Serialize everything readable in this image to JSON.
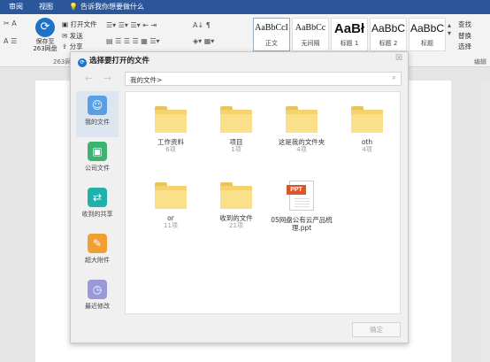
{
  "ribbon": {
    "tabs": [
      "审阅",
      "视图"
    ],
    "tell_me": "告诉我你想要做什么",
    "save263": "保存至263网盘",
    "group_label": "263网盘",
    "open_file": "打开文件",
    "send": "发送",
    "share": "分享",
    "styles": [
      {
        "sample": "AaBbCcI",
        "name": "正文"
      },
      {
        "sample": "AaBbCc",
        "name": "无间隔"
      },
      {
        "sample": "AaBł",
        "name": "标题 1"
      },
      {
        "sample": "AaBbC",
        "name": "标题 2"
      },
      {
        "sample": "AaBbC",
        "name": "标题"
      }
    ],
    "find": "查找",
    "replace": "替换",
    "select": "选择",
    "edit_group": "编辑"
  },
  "dialog": {
    "title": "选择要打开的文件",
    "path": "我的文件>",
    "sidebar": [
      {
        "label": "我的文件",
        "icon": "user-icon",
        "color": "#5a9ee6",
        "active": true
      },
      {
        "label": "公司文件",
        "icon": "briefcase-icon",
        "color": "#3cb371",
        "active": false
      },
      {
        "label": "收到的共享",
        "icon": "share-icon",
        "color": "#20b2aa",
        "active": false
      },
      {
        "label": "超大附件",
        "icon": "paperclip-icon",
        "color": "#f0a030",
        "active": false
      },
      {
        "label": "最近修改",
        "icon": "clock-icon",
        "color": "#9a9ad8",
        "active": false
      }
    ],
    "items": [
      {
        "name": "工作资料",
        "count": "6项",
        "type": "folder"
      },
      {
        "name": "项目",
        "count": "1项",
        "type": "folder"
      },
      {
        "name": "这是我的文件夹",
        "count": "4项",
        "type": "folder"
      },
      {
        "name": "oth",
        "count": "4项",
        "type": "folder"
      },
      {
        "name": "or",
        "count": "11项",
        "type": "folder"
      },
      {
        "name": "收到的文件",
        "count": "21项",
        "type": "folder"
      },
      {
        "name": "05网盘公有云产品梳理.ppt",
        "count": "",
        "type": "ppt"
      }
    ],
    "ppt_badge": "PPT",
    "ok": "确定"
  }
}
